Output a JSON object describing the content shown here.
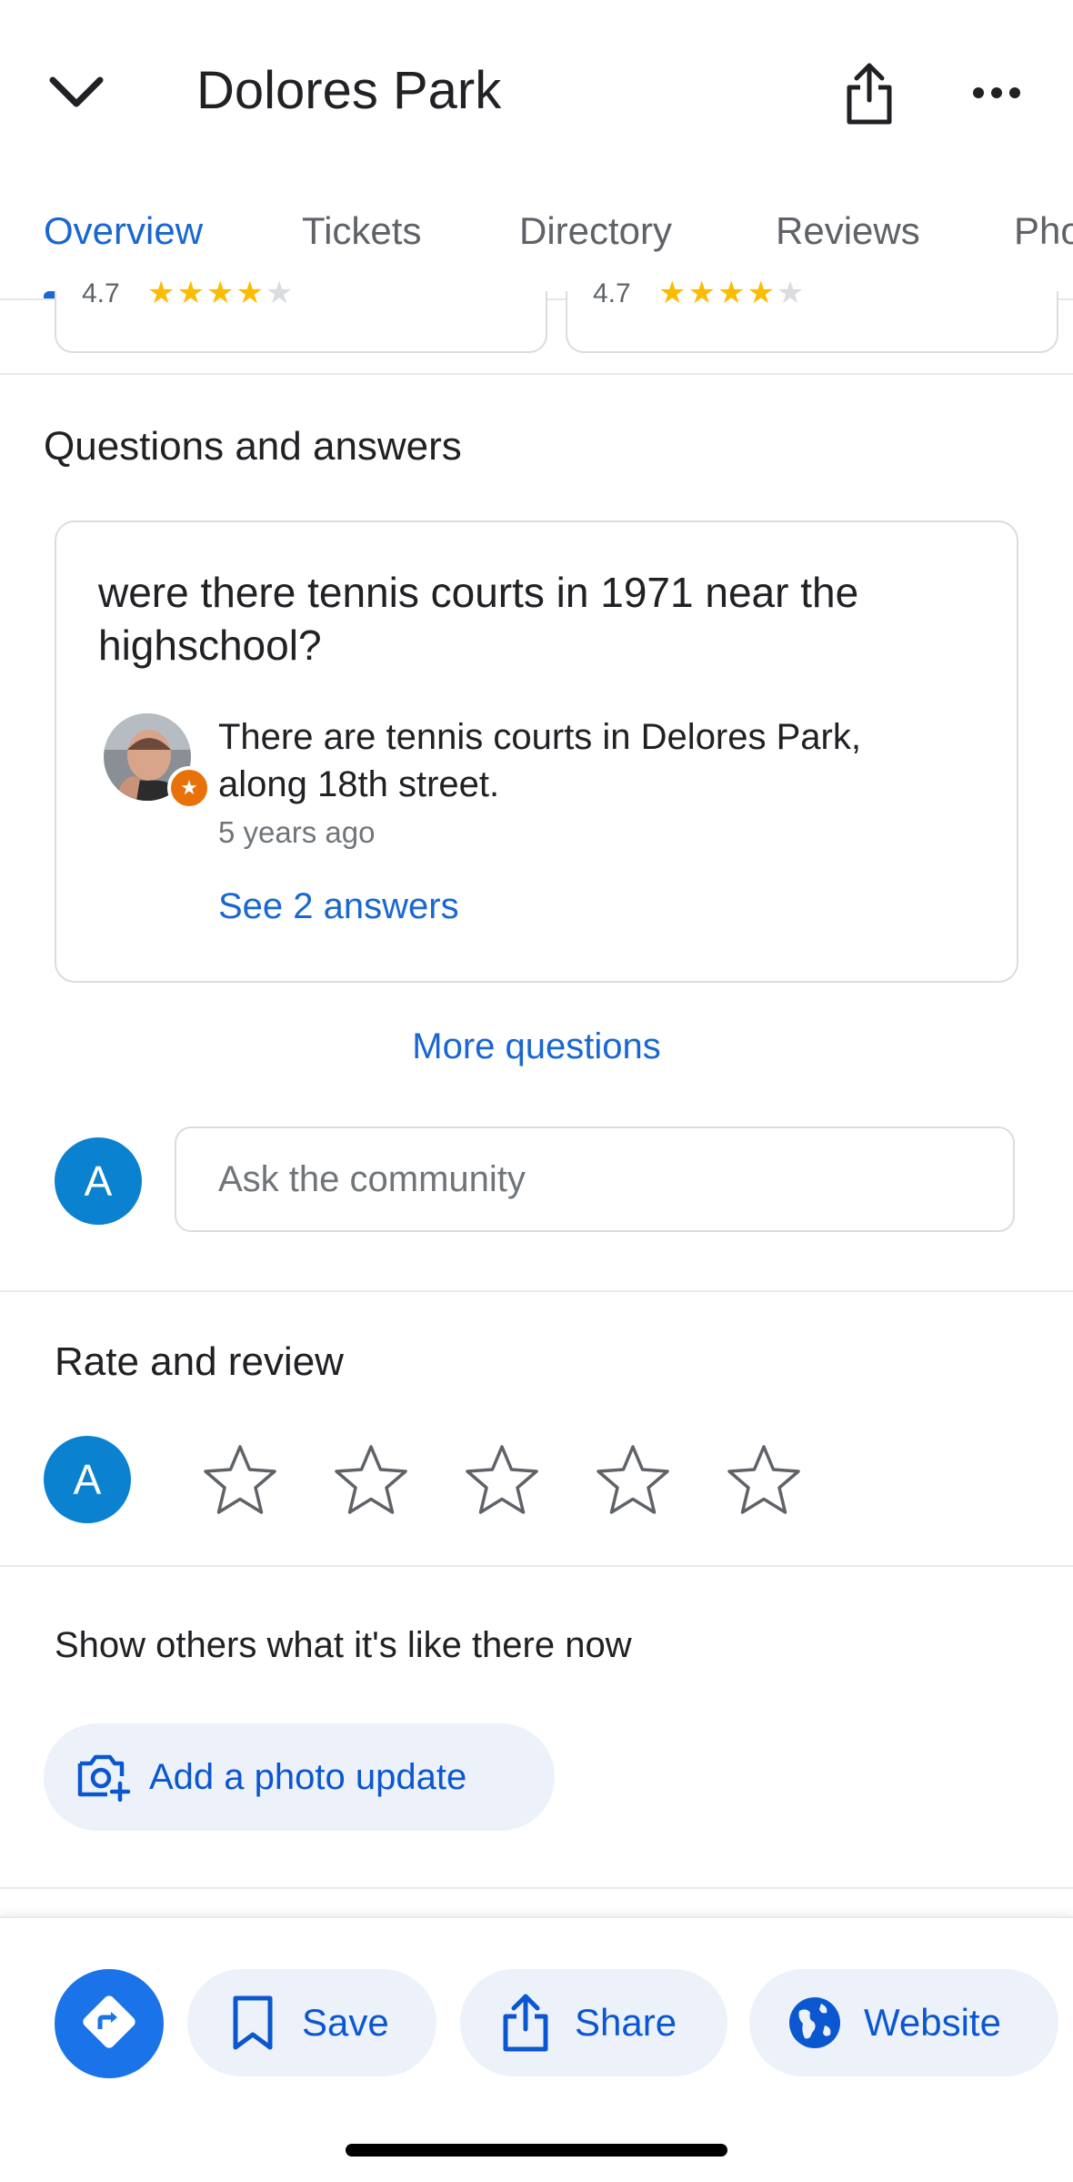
{
  "header": {
    "title": "Dolores Park"
  },
  "tabs": [
    {
      "label": "Overview",
      "active": true
    },
    {
      "label": "Tickets",
      "active": false
    },
    {
      "label": "Directory",
      "active": false
    },
    {
      "label": "Reviews",
      "active": false
    },
    {
      "label": "Pho",
      "active": false
    }
  ],
  "mini_cards": [
    {
      "rating": "4.7",
      "stars_filled": 4,
      "stars_total": 5
    },
    {
      "rating": "4.7",
      "stars_filled": 4,
      "stars_total": 5
    }
  ],
  "qa": {
    "title": "Questions and answers",
    "question": "were there tennis courts in 1971 near the highschool?",
    "answer": "There are tennis courts in Delores Park, along 18th street.",
    "answer_time": "5 years ago",
    "see_answers": "See 2 answers",
    "more_questions": "More questions",
    "ask": {
      "avatar_letter": "A",
      "placeholder": "Ask the community"
    }
  },
  "rate": {
    "title": "Rate and review",
    "avatar_letter": "A",
    "stars": 5
  },
  "photo_update": {
    "title": "Show others what it's like there now",
    "button_label": "Add a photo update"
  },
  "bottom_bar": {
    "directions_icon": "directions-icon",
    "save_label": "Save",
    "share_label": "Share",
    "website_label": "Website"
  },
  "colors": {
    "accent": "#1967d2",
    "button_blue": "#1a73e8",
    "pill_bg": "#edf2fa",
    "avatar_blue": "#0b82d0",
    "star_yellow": "#fbbc04",
    "local_guide_badge": "#e8710a"
  }
}
